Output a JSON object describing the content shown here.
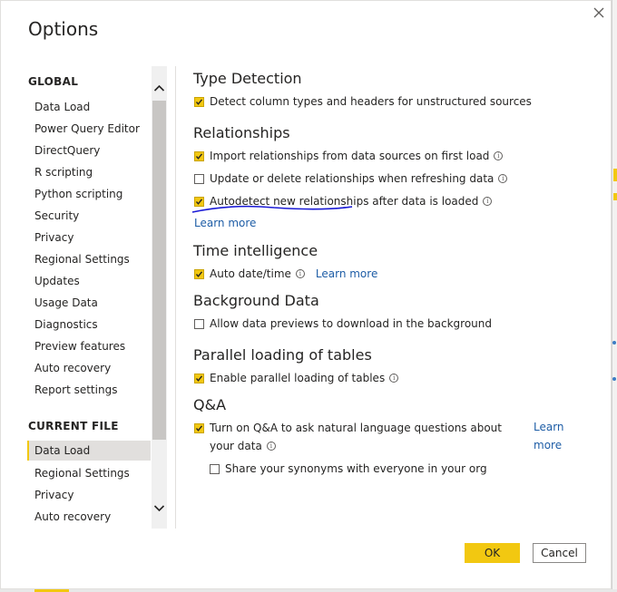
{
  "dialog": {
    "title": "Options",
    "close_icon": "close-icon",
    "accent_color": "#f2c811",
    "link_color": "#1e5da6"
  },
  "nav": {
    "global_header": "GLOBAL",
    "global_items": [
      {
        "label": "Data Load"
      },
      {
        "label": "Power Query Editor"
      },
      {
        "label": "DirectQuery"
      },
      {
        "label": "R scripting"
      },
      {
        "label": "Python scripting"
      },
      {
        "label": "Security"
      },
      {
        "label": "Privacy"
      },
      {
        "label": "Regional Settings"
      },
      {
        "label": "Updates"
      },
      {
        "label": "Usage Data"
      },
      {
        "label": "Diagnostics"
      },
      {
        "label": "Preview features"
      },
      {
        "label": "Auto recovery"
      },
      {
        "label": "Report settings"
      }
    ],
    "current_header": "CURRENT FILE",
    "current_items": [
      {
        "label": "Data Load",
        "selected": true
      },
      {
        "label": "Regional Settings"
      },
      {
        "label": "Privacy"
      },
      {
        "label": "Auto recovery"
      }
    ]
  },
  "content": {
    "type_detection": {
      "heading": "Type Detection",
      "detect_columns": {
        "label": "Detect column types and headers for unstructured sources",
        "checked": true
      }
    },
    "relationships": {
      "heading": "Relationships",
      "import": {
        "label": "Import relationships from data sources on first load",
        "checked": true
      },
      "update": {
        "label": "Update or delete relationships when refreshing data",
        "checked": false
      },
      "autodetect": {
        "label": "Autodetect new relationships after data is loaded",
        "checked": true
      },
      "learn_more": "Learn more"
    },
    "time_intelligence": {
      "heading": "Time intelligence",
      "auto_datetime": {
        "label": "Auto date/time",
        "checked": true
      },
      "learn_more": "Learn more"
    },
    "background_data": {
      "heading": "Background Data",
      "allow_previews": {
        "label": "Allow data previews to download in the background",
        "checked": false
      }
    },
    "parallel_loading": {
      "heading": "Parallel loading of tables",
      "enable": {
        "label": "Enable parallel loading of tables",
        "checked": true
      }
    },
    "qa": {
      "heading": "Q&A",
      "turn_on_line1": "Turn on Q&A to ask natural language questions about",
      "turn_on_line2": "your data",
      "turn_on_checked": true,
      "learn_more_line1": "Learn",
      "learn_more_line2": "more",
      "share_synonyms": {
        "label": "Share your synonyms with everyone in your org",
        "checked": false
      }
    }
  },
  "footer": {
    "ok_label": "OK",
    "cancel_label": "Cancel"
  }
}
